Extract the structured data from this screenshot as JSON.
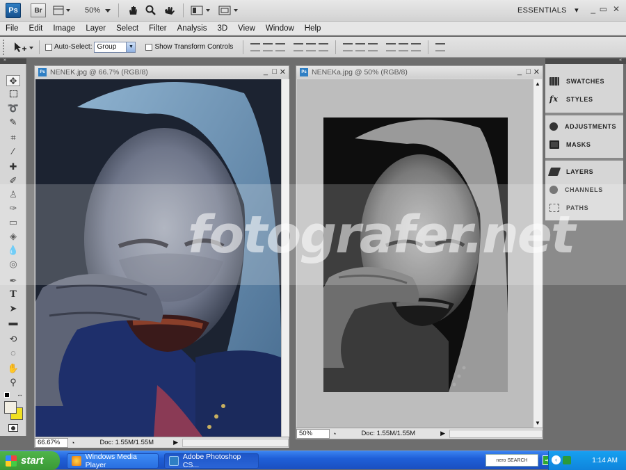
{
  "appbar": {
    "ps_logo": "Ps",
    "br_logo": "Br",
    "zoom": "50%",
    "workspace": "ESSENTIALS",
    "controls": [
      "_",
      "▭",
      "✕"
    ]
  },
  "menu": [
    "File",
    "Edit",
    "Image",
    "Layer",
    "Select",
    "Filter",
    "Analysis",
    "3D",
    "View",
    "Window",
    "Help"
  ],
  "options": {
    "auto_select_label": "Auto-Select:",
    "auto_select_value": "Group",
    "transform_label": "Show Transform Controls"
  },
  "documents": [
    {
      "title": "NENEK.jpg @ 66.7% (RGB/8)",
      "zoom": "66.67%",
      "doc": "Doc: 1.55M/1.55M"
    },
    {
      "title": "NENEKa.jpg @ 50% (RGB/8)",
      "zoom": "50%",
      "doc": "Doc: 1.55M/1.55M"
    }
  ],
  "panels": {
    "swatches": "SWATCHES",
    "styles": "STYLES",
    "adjustments": "ADJUSTMENTS",
    "masks": "MASKS",
    "layers": "LAYERS",
    "channels": "CHANNELS",
    "paths": "PATHS"
  },
  "watermark": "fotografer.net",
  "taskbar": {
    "start": "start",
    "tasks": [
      "Windows Media Player",
      "Adobe Photoshop CS..."
    ],
    "nero": "nero SEARCH",
    "clock": "1:14 AM"
  },
  "colors": {
    "accent": "#2f7fc4",
    "taskbar": "#245edb",
    "start": "#3c9b37"
  }
}
